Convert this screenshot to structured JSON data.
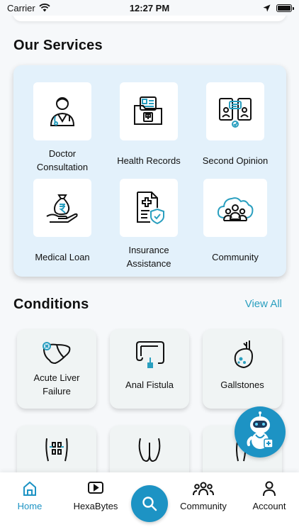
{
  "status_bar": {
    "carrier": "Carrier",
    "time": "12:27 PM"
  },
  "services": {
    "title": "Our Services",
    "items": [
      {
        "label_lines": [
          "Doctor",
          "Consultation"
        ],
        "icon": "doctor-icon"
      },
      {
        "label_lines": [
          "Health Records"
        ],
        "icon": "health-records-icon"
      },
      {
        "label_lines": [
          "Second Opinion"
        ],
        "icon": "second-opinion-icon"
      },
      {
        "label_lines": [
          "Medical Loan"
        ],
        "icon": "medical-loan-icon"
      },
      {
        "label_lines": [
          "Insurance",
          "Assistance"
        ],
        "icon": "insurance-icon"
      },
      {
        "label_lines": [
          "Community"
        ],
        "icon": "community-cloud-icon"
      }
    ]
  },
  "conditions": {
    "title": "Conditions",
    "view_all": "View All",
    "items": [
      {
        "label_lines": [
          "Acute Liver",
          "Failure"
        ],
        "icon": "liver-icon"
      },
      {
        "label_lines": [
          "Anal Fistula"
        ],
        "icon": "intestine-icon"
      },
      {
        "label_lines": [
          "Gallstones"
        ],
        "icon": "gallbladder-icon"
      },
      {
        "label_lines": [
          ""
        ],
        "icon": "abdomen-icon"
      },
      {
        "label_lines": [
          ""
        ],
        "icon": "buttocks-icon"
      },
      {
        "label_lines": [
          ""
        ],
        "icon": "leg-icon"
      }
    ]
  },
  "tab_bar": {
    "items": [
      {
        "label": "Home",
        "icon": "home-icon",
        "active": true
      },
      {
        "label": "HexaBytes",
        "icon": "video-play-icon",
        "active": false
      },
      {
        "label": "Community",
        "icon": "people-icon",
        "active": false
      },
      {
        "label": "Account",
        "icon": "person-icon",
        "active": false
      }
    ],
    "search_icon": "search-icon"
  },
  "colors": {
    "accent": "#1d93c4",
    "services_bg": "#e3f1fb",
    "link": "#2a9fbf"
  }
}
